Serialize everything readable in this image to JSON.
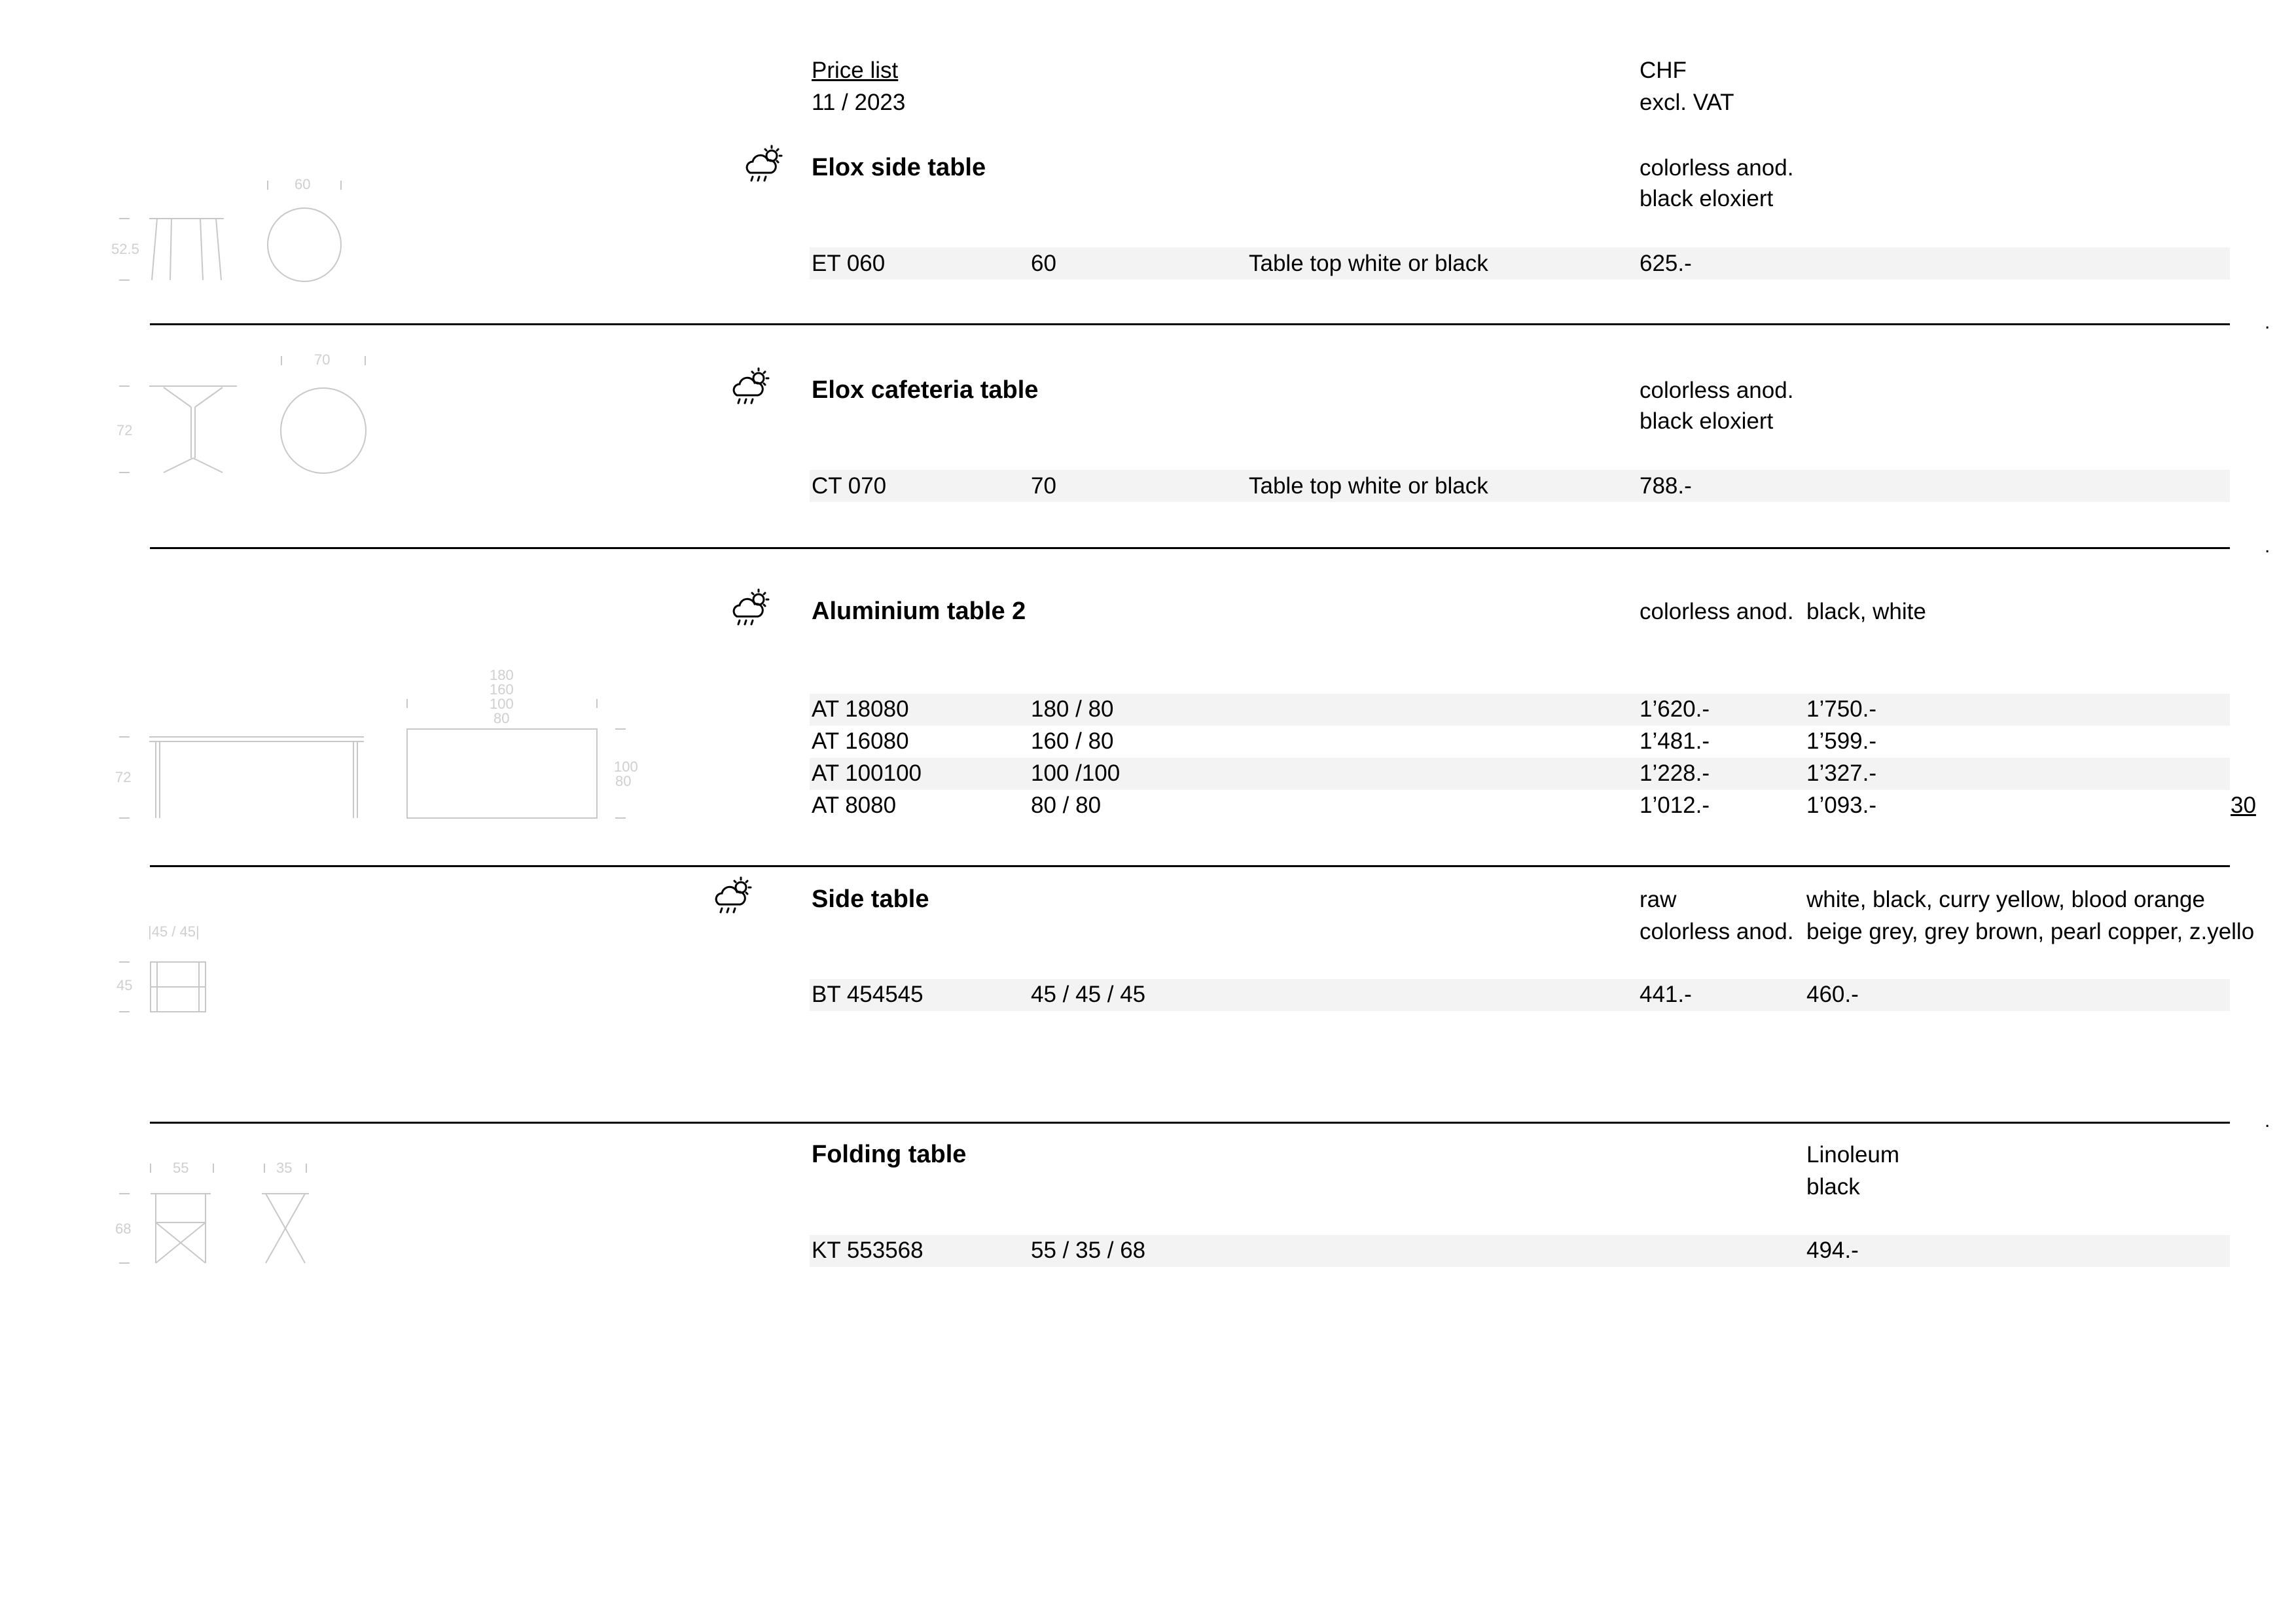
{
  "header": {
    "title": "Price list",
    "date": "11 / 2023",
    "currency": "CHF",
    "vat": "excl. VAT"
  },
  "page_number": "30",
  "icons": {
    "weather": "weatherproof-cloud-sun-icon"
  },
  "sections": [
    {
      "name": "Elox side table",
      "finishes": [
        "colorless anod.",
        "black eloxiert"
      ],
      "dims": {
        "top": "60",
        "left": "52.5"
      },
      "rows": [
        {
          "code": "ET 060",
          "size": "60",
          "note": "Table top white or black",
          "price1": "625.-",
          "price2": ""
        }
      ]
    },
    {
      "name": "Elox cafeteria table",
      "finishes": [
        "colorless anod.",
        "black eloxiert"
      ],
      "dims": {
        "top": "70",
        "left": "72"
      },
      "rows": [
        {
          "code": "CT 070",
          "size": "70",
          "note": "Table top white or black",
          "price1": "788.-",
          "price2": ""
        }
      ]
    },
    {
      "name": "Aluminium table 2",
      "finishes": [
        "colorless anod."
      ],
      "finish2": "black, white",
      "dims": {
        "top": [
          "180",
          "160",
          "100",
          "80"
        ],
        "left": "72",
        "right": [
          "100",
          "80"
        ]
      },
      "rows": [
        {
          "code": "AT 18080",
          "size": "180 / 80",
          "note": "",
          "price1": "1’620.-",
          "price2": "1’750.-"
        },
        {
          "code": "AT 16080",
          "size": "160 / 80",
          "note": "",
          "price1": "1’481.-",
          "price2": "1’599.-"
        },
        {
          "code": "AT 100100",
          "size": "100 /100",
          "note": "",
          "price1": "1’228.-",
          "price2": "1’327.-"
        },
        {
          "code": "AT 8080",
          "size": "80 / 80",
          "note": "",
          "price1": "1’012.-",
          "price2": "1’093.-"
        }
      ]
    },
    {
      "name": "Side table",
      "finishes": [
        "raw",
        "colorless anod."
      ],
      "finish2": [
        "white, black, curry yellow, blood orange",
        "beige grey, grey brown, pearl copper, z.yello"
      ],
      "dims": {
        "top": "|45 / 45|",
        "left": "45"
      },
      "rows": [
        {
          "code": "BT 454545",
          "size": "45 / 45 / 45",
          "note": "",
          "price1": "441.-",
          "price2": "460.-"
        }
      ]
    },
    {
      "name": "Folding table",
      "finish2": [
        "Linoleum",
        "black"
      ],
      "dims": {
        "top1": "55",
        "top2": "35",
        "left": "68"
      },
      "rows": [
        {
          "code": "KT 553568",
          "size": "55 / 35 / 68",
          "note": "",
          "price1": "",
          "price2": "494.-"
        }
      ]
    }
  ]
}
